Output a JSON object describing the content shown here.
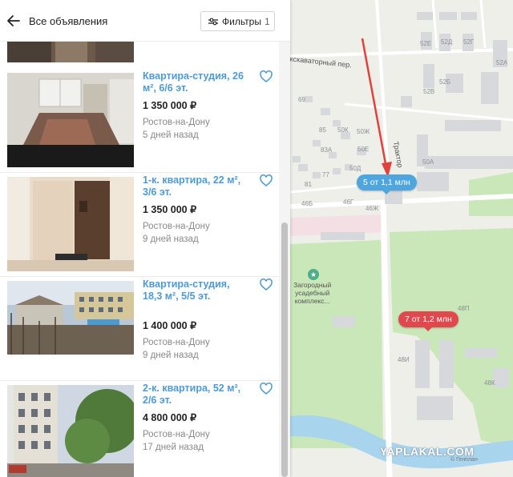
{
  "header": {
    "back_label": "Все объявления",
    "filters_label": "Фильтры",
    "filters_count": "1"
  },
  "listings": [
    {
      "title": "Квартира-студия, 26 м², 6/6 эт.",
      "price": "1 350 000 ₽",
      "city": "Ростов-на-Дону",
      "date": "5 дней назад"
    },
    {
      "title": "1-к. квартира, 22 м², 3/6 эт.",
      "price": "1 350 000 ₽",
      "city": "Ростов-на-Дону",
      "date": "9 дней назад"
    },
    {
      "title": "Квартира-студия, 18,3 м², 5/5 эт.",
      "price": "1 400 000 ₽",
      "city": "Ростов-на-Дону",
      "date": "9 дней назад"
    },
    {
      "title": "2-к. квартира, 52 м², 2/6 эт.",
      "price": "4 800 000 ₽",
      "city": "Ростов-на-Дону",
      "date": "17 дней назад"
    }
  ],
  "map": {
    "pins": [
      {
        "label": "5 от 1,1 млн",
        "color": "#4fa6df"
      },
      {
        "label": "7 от 1,2 млн",
        "color": "#e0484d"
      }
    ],
    "streets": {
      "excavator": "Экскаваторный пер.",
      "tractor": "Трактор"
    },
    "poi": {
      "name": "Загородный\nусадебный\nкомплекс..."
    },
    "house_numbers": [
      "52Е",
      "52Д",
      "52Г",
      "52А",
      "52Б",
      "52В",
      "69",
      "85",
      "50К",
      "50Ж",
      "83А",
      "50Е",
      "81",
      "77",
      "50Д",
      "46Б",
      "46Г",
      "46Ж",
      "50А",
      "48П",
      "48И",
      "48К"
    ],
    "attribution": "© Генплан",
    "watermark": "YAPLAKAL.COM"
  },
  "colors": {
    "accent_link": "#4d9ad6",
    "pin_blue": "#4fa6df",
    "pin_red": "#e0484d",
    "annotation_arrow": "#e2403b"
  }
}
